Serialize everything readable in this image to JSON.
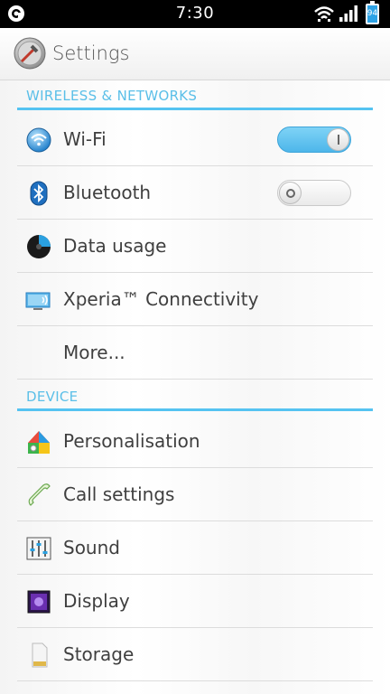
{
  "status_bar": {
    "time": "7:30",
    "battery_level": "94",
    "icons": [
      "app-notification-icon",
      "wifi-icon",
      "signal-icon",
      "battery-icon"
    ]
  },
  "action_bar": {
    "title": "Settings",
    "icon": "settings-app-icon"
  },
  "sections": {
    "wireless": {
      "header": "WIRELESS & NETWORKS",
      "items": [
        {
          "label": "Wi-Fi",
          "icon": "wifi-icon",
          "toggle": "on"
        },
        {
          "label": "Bluetooth",
          "icon": "bluetooth-icon",
          "toggle": "off"
        },
        {
          "label": "Data usage",
          "icon": "data-usage-icon"
        },
        {
          "label": "Xperia™ Connectivity",
          "icon": "xperia-connectivity-icon"
        },
        {
          "label": "More..."
        }
      ]
    },
    "device": {
      "header": "DEVICE",
      "items": [
        {
          "label": "Personalisation",
          "icon": "personalisation-icon"
        },
        {
          "label": "Call settings",
          "icon": "phone-icon"
        },
        {
          "label": "Sound",
          "icon": "sound-sliders-icon"
        },
        {
          "label": "Display",
          "icon": "display-icon"
        },
        {
          "label": "Storage",
          "icon": "sd-card-icon"
        }
      ]
    }
  },
  "colors": {
    "accent": "#55c3f1",
    "toggle_on": "#4db6ea",
    "status_bar": "#000000"
  }
}
